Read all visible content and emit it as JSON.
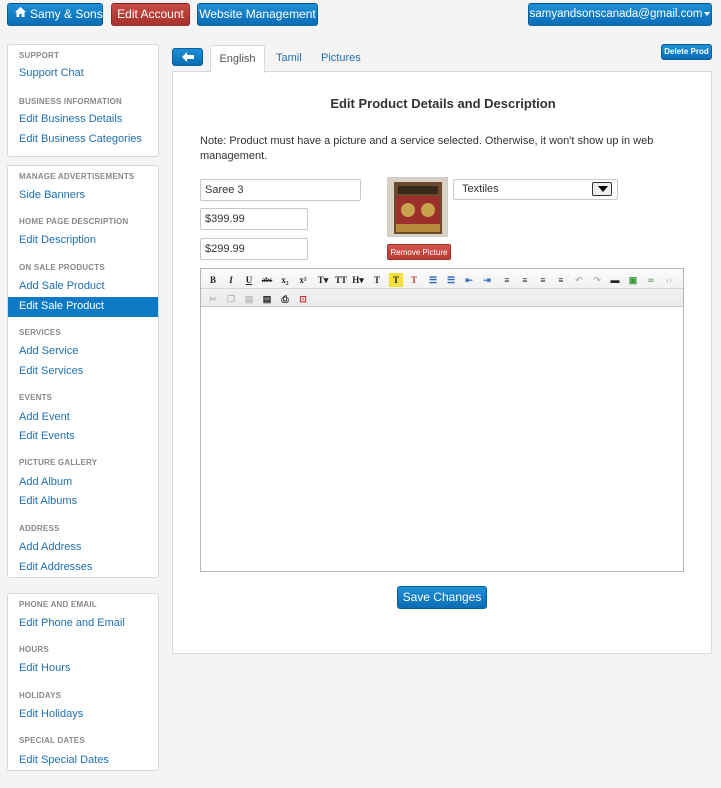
{
  "topbar": {
    "brand": "Samy & Sons",
    "edit_account": "Edit Account",
    "website_management": "Website Management",
    "account_email": "samyandsonscanada@gmail.com"
  },
  "sidebar": {
    "support": {
      "heading": "SUPPORT",
      "links": [
        "Support Chat"
      ]
    },
    "business_information": {
      "heading": "BUSINESS INFORMATION",
      "links": [
        "Edit Business Details",
        "Edit Business Categories"
      ]
    },
    "manage_advertisements": {
      "heading": "MANAGE ADVERTISEMENTS",
      "links": [
        "Side Banners"
      ]
    },
    "home_page_description": {
      "heading": "HOME PAGE DESCRIPTION",
      "links": [
        "Edit Description"
      ]
    },
    "on_sale_products": {
      "heading": "ON SALE PRODUCTS",
      "links": [
        "Add Sale Product",
        "Edit Sale Product"
      ]
    },
    "services": {
      "heading": "SERVICES",
      "links": [
        "Add Service",
        "Edit Services"
      ]
    },
    "events": {
      "heading": "EVENTS",
      "links": [
        "Add Event",
        "Edit Events"
      ]
    },
    "picture_gallery": {
      "heading": "PICTURE GALLERY",
      "links": [
        "Add Album",
        "Edit Albums"
      ]
    },
    "address": {
      "heading": "ADDRESS",
      "links": [
        "Add Address",
        "Edit Addresses"
      ]
    },
    "phone_and_email": {
      "heading": "PHONE AND EMAIL",
      "links": [
        "Edit Phone and Email"
      ]
    },
    "hours": {
      "heading": "HOURS",
      "links": [
        "Edit Hours"
      ]
    },
    "holidays": {
      "heading": "HOLIDAYS",
      "links": [
        "Edit Holidays"
      ]
    },
    "special_dates": {
      "heading": "SPECIAL DATES",
      "links": [
        "Edit Special Dates"
      ]
    }
  },
  "tabs": {
    "english": "English",
    "tamil": "Tamil",
    "pictures": "Pictures"
  },
  "delete_prod": "Delete Prod",
  "form": {
    "title": "Edit Product Details and Description",
    "note": "Note: Product must have a picture and a service selected. Otherwise, it won't show up in web management.",
    "name_value": "Saree 3",
    "price_value": "$399.99",
    "sale_price_value": "$299.99",
    "service_selected": "Textiles",
    "remove_picture": "Remove Picture",
    "save_changes": "Save Changes"
  },
  "colors": {
    "primary_blue": "#0e7ac6",
    "danger_red": "#b73b34",
    "link_blue": "#1f6fb0"
  }
}
